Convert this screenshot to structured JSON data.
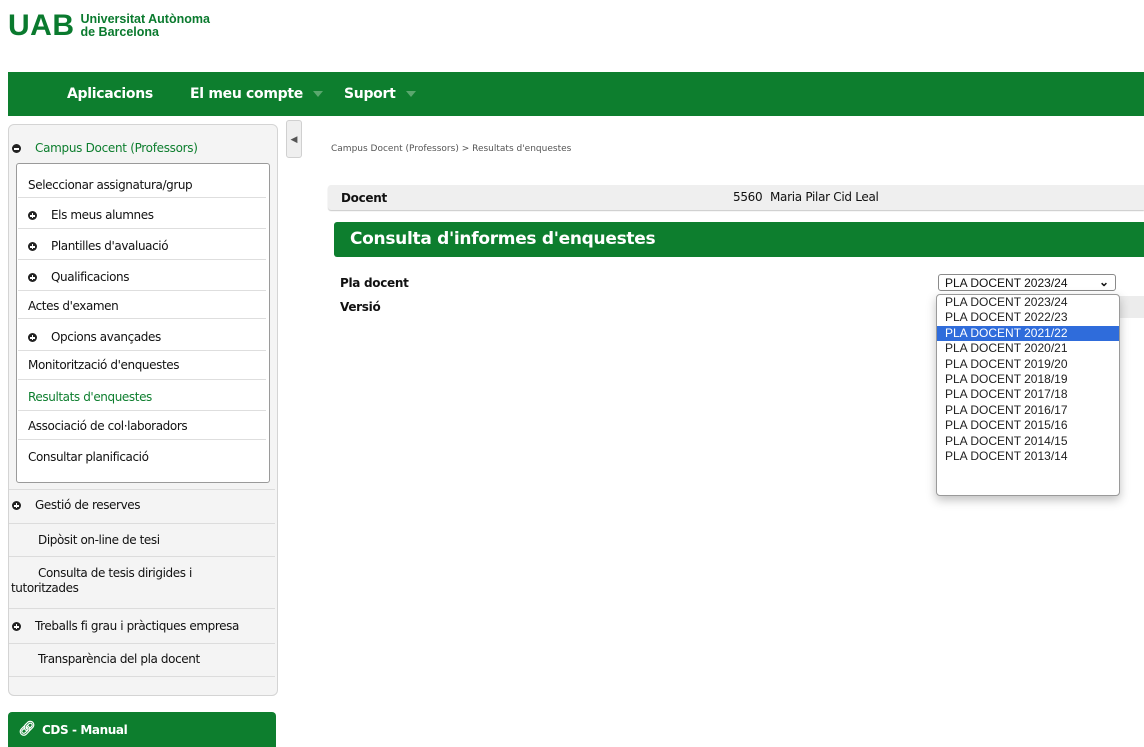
{
  "brand": {
    "logo_mark": "UAB",
    "logo_line1": "Universitat Autònoma",
    "logo_line2": "de Barcelona",
    "color": "#0d7e2e"
  },
  "topnav": {
    "items": [
      {
        "label": "Aplicacions"
      },
      {
        "label": "El meu compte"
      },
      {
        "label": "Suport"
      }
    ]
  },
  "sidebar": {
    "section_title": "Campus Docent (Professors)",
    "items": [
      {
        "label": "Seleccionar assignatura/grup"
      },
      {
        "label": "Els meus alumnes"
      },
      {
        "label": "Plantilles d'avaluació"
      },
      {
        "label": "Qualificacions"
      },
      {
        "label": "Actes d'examen"
      },
      {
        "label": "Opcions avançades"
      },
      {
        "label": "Monitorització d'enquestes"
      },
      {
        "label": "Resultats d'enquestes"
      },
      {
        "label": "Associació de col·laboradors"
      },
      {
        "label": "Consultar planificació"
      }
    ],
    "lower": [
      {
        "label": "Gestió de reserves"
      },
      {
        "label": "Dipòsit on-line de tesi"
      },
      {
        "label_line1": "Consulta de tesis dirigides i",
        "label_line2": "tutoritzades"
      },
      {
        "label": "Treballs fi grau i pràctiques empresa"
      },
      {
        "label": "Transparència del pla docent"
      }
    ],
    "manual_link": "CDS - Manual"
  },
  "main": {
    "breadcrumb": "Campus Docent (Professors) > Resultats d'enquestes",
    "docent_label": "Docent",
    "docent_id": "5560",
    "docent_name": "Maria Pilar Cid Leal",
    "section_title": "Consulta d'informes d'enquestes",
    "pla_label": "Pla docent",
    "versio_label": "Versió",
    "select_value": "PLA DOCENT 2023/24",
    "options": [
      "PLA DOCENT 2023/24",
      "PLA DOCENT 2022/23",
      "PLA DOCENT 2021/22",
      "PLA DOCENT 2020/21",
      "PLA DOCENT 2019/20",
      "PLA DOCENT 2018/19",
      "PLA DOCENT 2017/18",
      "PLA DOCENT 2016/17",
      "PLA DOCENT 2015/16",
      "PLA DOCENT 2014/15",
      "PLA DOCENT 2013/14"
    ],
    "highlighted_option": "PLA DOCENT 2021/22"
  }
}
